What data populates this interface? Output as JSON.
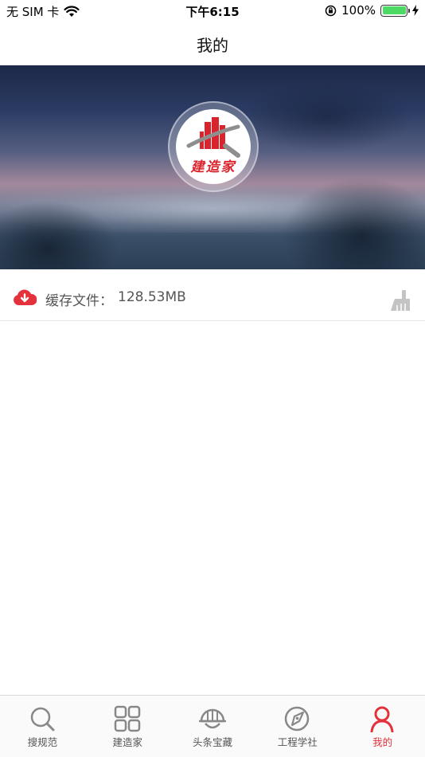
{
  "status_bar": {
    "carrier": "无 SIM 卡",
    "time": "下午6:15",
    "battery_percent": "100%",
    "battery_level": 1.0
  },
  "nav": {
    "title": "我的"
  },
  "banner": {
    "logo_text": "建造家"
  },
  "cache": {
    "label": "缓存文件：",
    "value": "128.53MB",
    "icon": "download-cloud-icon",
    "action_icon": "broom-icon"
  },
  "tabs": [
    {
      "label": "搜规范",
      "icon": "search-icon",
      "active": false
    },
    {
      "label": "建造家",
      "icon": "grid-icon",
      "active": false
    },
    {
      "label": "头条宝藏",
      "icon": "helmet-icon",
      "active": false
    },
    {
      "label": "工程学社",
      "icon": "compass-icon",
      "active": false
    },
    {
      "label": "我的",
      "icon": "person-icon",
      "active": true
    }
  ],
  "colors": {
    "accent": "#e4323c",
    "inactive": "#888888",
    "logo_red": "#d9232d"
  }
}
